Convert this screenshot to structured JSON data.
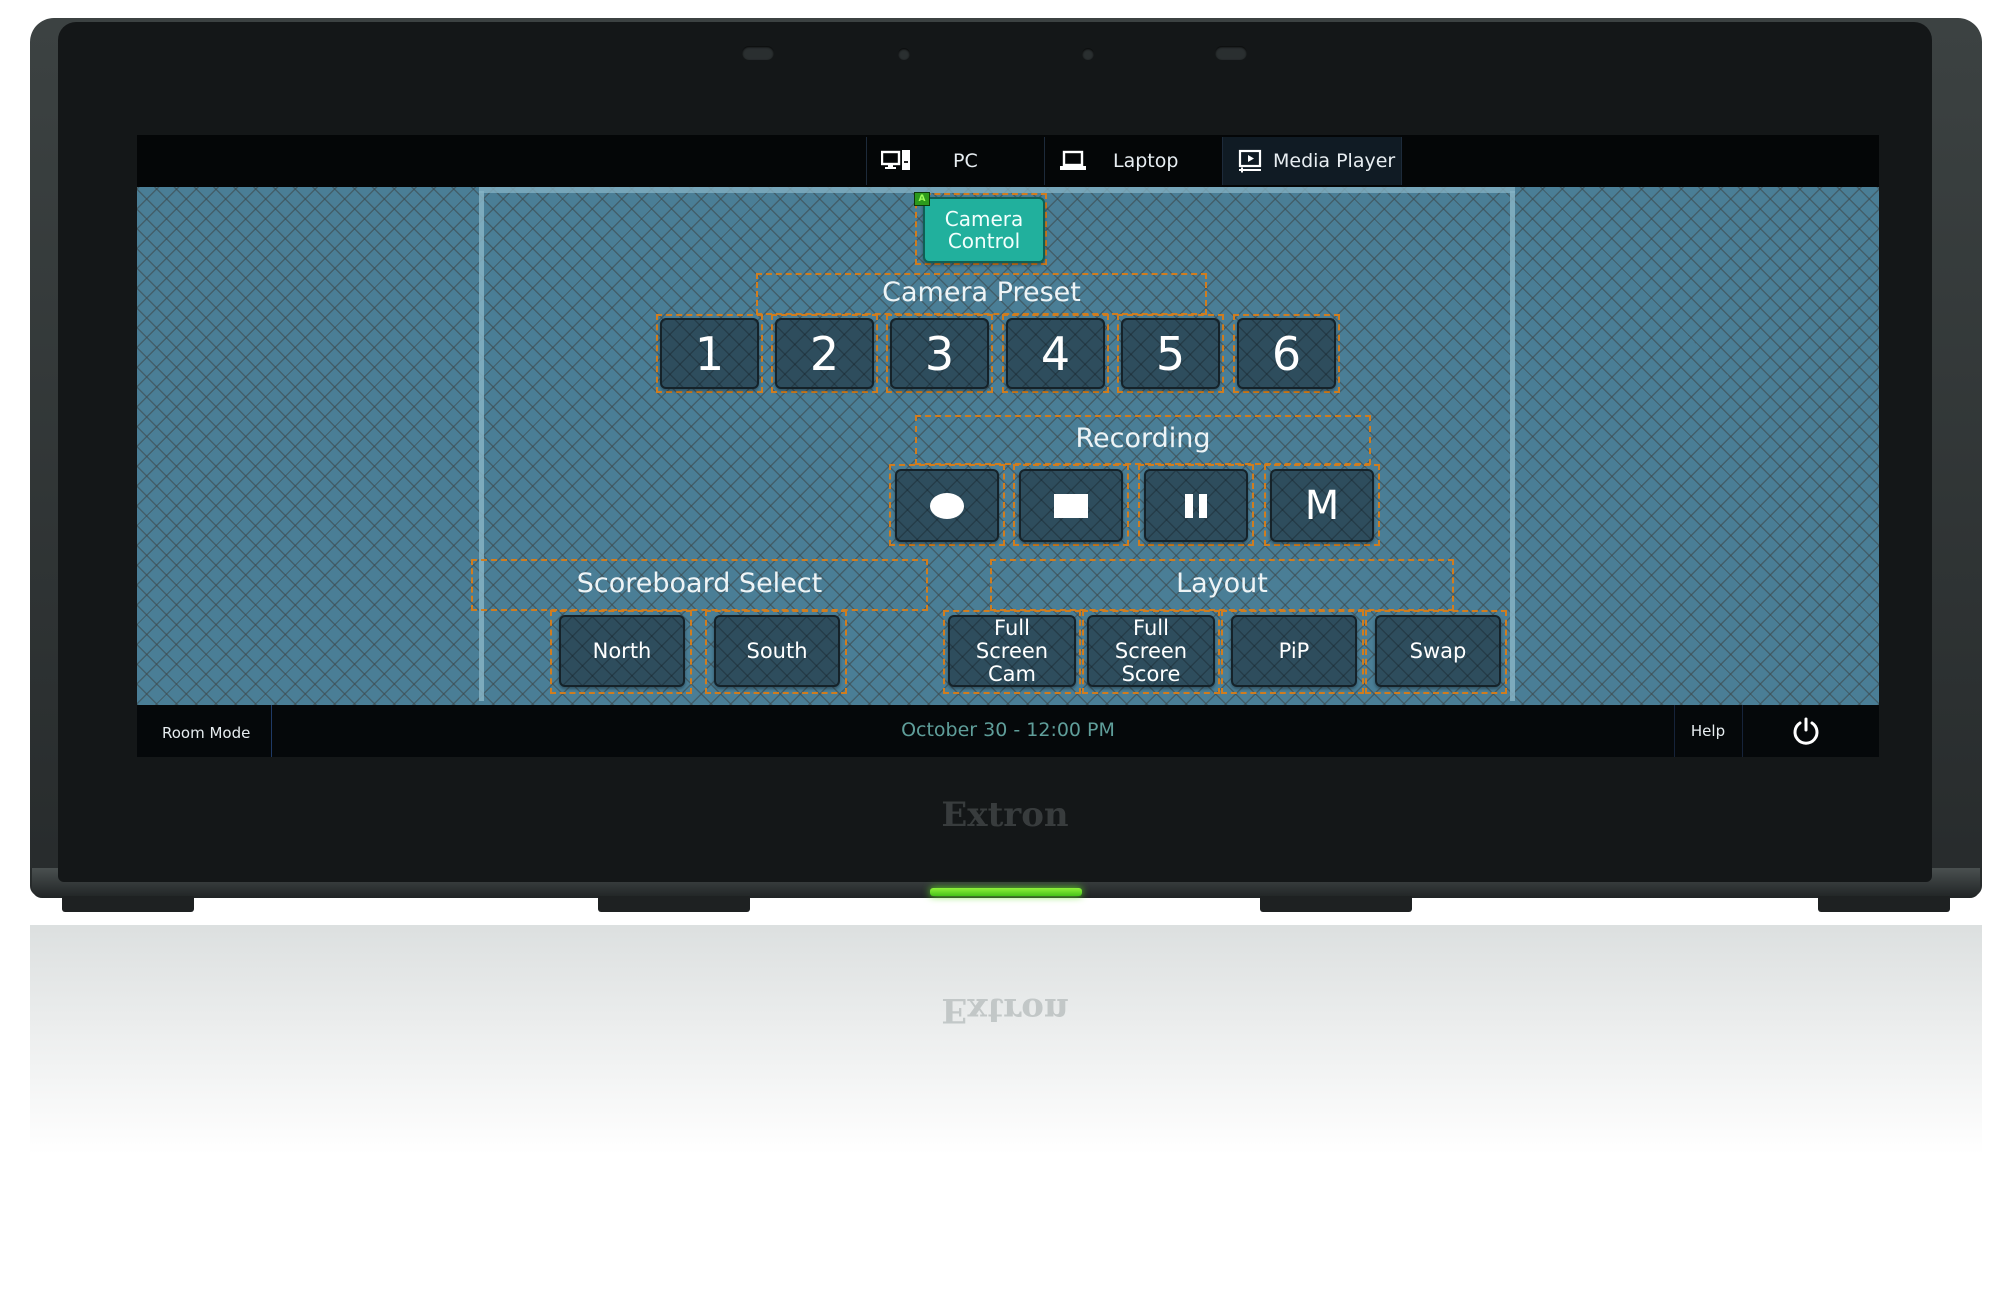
{
  "device": {
    "brand": "Extron",
    "led_color": "#5fdc25"
  },
  "topbar": {
    "tabs": [
      {
        "label": "PC",
        "icon": "desktop-pc-icon",
        "active": false
      },
      {
        "label": "Laptop",
        "icon": "laptop-icon",
        "active": false
      },
      {
        "label": "Media Player",
        "icon": "media-player-icon",
        "active": true
      }
    ]
  },
  "camera_control": {
    "label_line1": "Camera",
    "label_line2": "Control",
    "badge": "A",
    "color": "#21b09d"
  },
  "camera_preset": {
    "title": "Camera Preset",
    "buttons": [
      "1",
      "2",
      "3",
      "4",
      "5",
      "6"
    ]
  },
  "recording": {
    "title": "Recording",
    "buttons": [
      {
        "name": "record",
        "icon": "record-icon"
      },
      {
        "name": "stop",
        "icon": "stop-icon"
      },
      {
        "name": "pause",
        "icon": "pause-icon"
      },
      {
        "name": "mark",
        "label": "M"
      }
    ]
  },
  "scoreboard_select": {
    "title": "Scoreboard Select",
    "buttons": [
      "North",
      "South"
    ]
  },
  "layout": {
    "title": "Layout",
    "buttons": [
      {
        "line1": "Full",
        "line2": "Screen",
        "line3": "Cam"
      },
      {
        "line1": "Full",
        "line2": "Screen",
        "line3": "Score"
      },
      {
        "label": "PiP"
      },
      {
        "label": "Swap"
      }
    ]
  },
  "bottombar": {
    "room_mode": "Room Mode",
    "datetime": "October 30 - 12:00 PM",
    "help": "Help",
    "power_icon": "power-icon"
  },
  "colors": {
    "background_panel": "#4a7e96",
    "button": "#2e4d5d",
    "guide_outline": "#d07d1f",
    "datetime_text": "#5f9e9a"
  }
}
